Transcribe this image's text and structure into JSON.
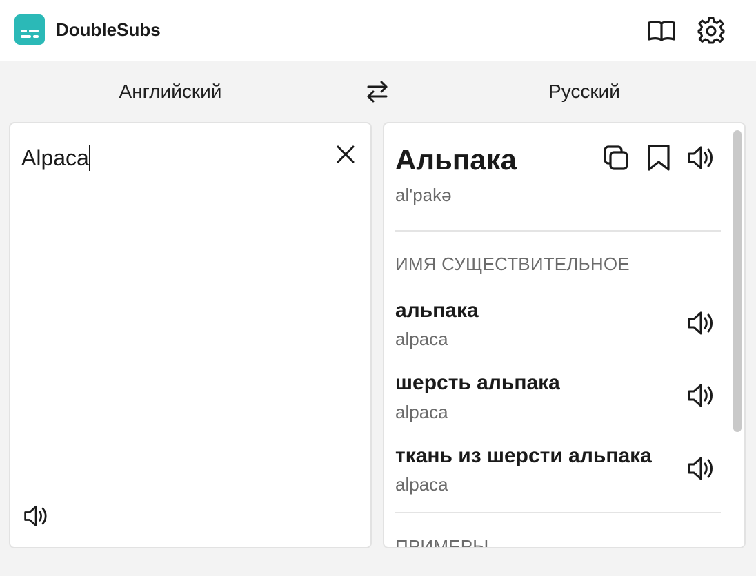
{
  "app": {
    "title": "DoubleSubs"
  },
  "header": {
    "icons": [
      "book-icon",
      "gear-icon"
    ]
  },
  "languages": {
    "source": "Английский",
    "target": "Русский"
  },
  "input": {
    "text": "Alpaca"
  },
  "result": {
    "headword": "Альпака",
    "transcription": "al'pakə",
    "part_of_speech": "ИМЯ СУЩЕСТВИТЕЛЬНОЕ",
    "translations": [
      {
        "word": "альпака",
        "back": "alpaca"
      },
      {
        "word": "шерсть альпака",
        "back": "alpaca"
      },
      {
        "word": "ткань из шерсти альпака",
        "back": "alpaca"
      }
    ],
    "examples_title": "ПРИМЕРЫ"
  },
  "colors": {
    "accent": "#2bb9b7",
    "background": "#f3f3f3",
    "muted_text": "#6b6b6b"
  }
}
